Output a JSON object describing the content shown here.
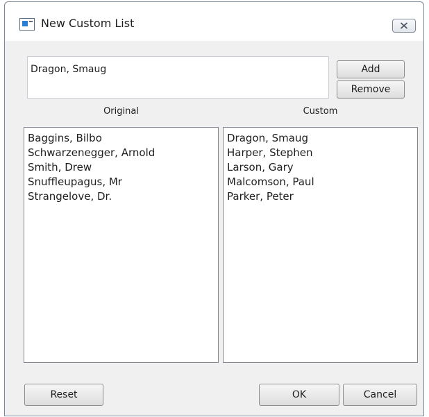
{
  "window": {
    "title": "New Custom List",
    "title_icon": "app-window-icon",
    "close_icon": "close-icon"
  },
  "entry": {
    "value": "Dragon, Smaug"
  },
  "buttons": {
    "add": "Add",
    "remove": "Remove",
    "reset": "Reset",
    "ok": "OK",
    "cancel": "Cancel"
  },
  "original": {
    "header": "Original",
    "items": [
      "Baggins, Bilbo",
      "Schwarzenegger, Arnold",
      "Smith, Drew",
      "Snuffleupagus, Mr",
      "Strangelove, Dr."
    ]
  },
  "custom": {
    "header": "Custom",
    "items": [
      "Dragon, Smaug",
      "Harper, Stephen",
      "Larson, Gary",
      "Malcomson, Paul",
      "Parker, Peter"
    ]
  }
}
